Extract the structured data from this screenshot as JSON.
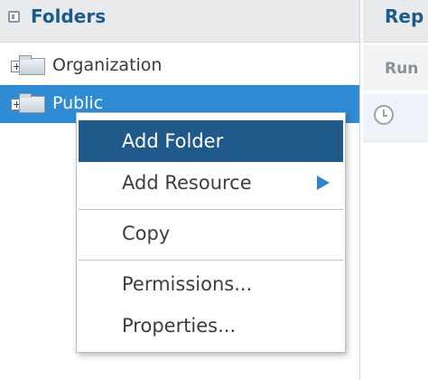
{
  "folders_panel": {
    "title": "Folders",
    "items": [
      {
        "label": "Organization"
      },
      {
        "label": "Public"
      }
    ]
  },
  "right_panel": {
    "title": "Rep",
    "column_header": "Run"
  },
  "context_menu": {
    "items": [
      {
        "label": "Add Folder"
      },
      {
        "label": "Add Resource"
      },
      {
        "label": "Copy"
      },
      {
        "label": "Permissions..."
      },
      {
        "label": "Properties..."
      }
    ]
  },
  "colors": {
    "selection": "#2f8bd4",
    "menu_highlight": "#1f5a8a",
    "header_text": "#1d5a8c",
    "submenu_arrow": "#2f86cc"
  },
  "icons": [
    "panel-icon",
    "folder-icon",
    "expand-icon",
    "clock-icon",
    "submenu-arrow-icon"
  ]
}
